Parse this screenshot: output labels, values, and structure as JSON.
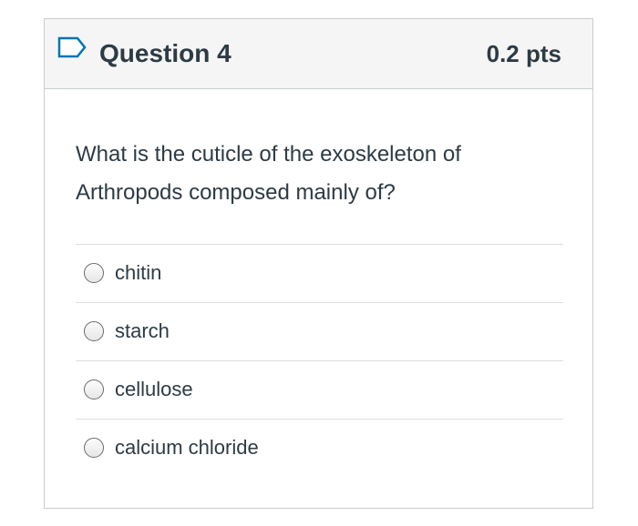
{
  "question": {
    "title": "Question 4",
    "points": "0.2 pts",
    "text": "What is the cuticle of the exoskeleton of Arthropods composed mainly of?",
    "flag_icon": "flag-outline-icon",
    "accent_color": "#0374b5"
  },
  "answers": [
    {
      "label": "chitin",
      "selected": false
    },
    {
      "label": "starch",
      "selected": false
    },
    {
      "label": "cellulose",
      "selected": false
    },
    {
      "label": "calcium chloride",
      "selected": false
    }
  ]
}
